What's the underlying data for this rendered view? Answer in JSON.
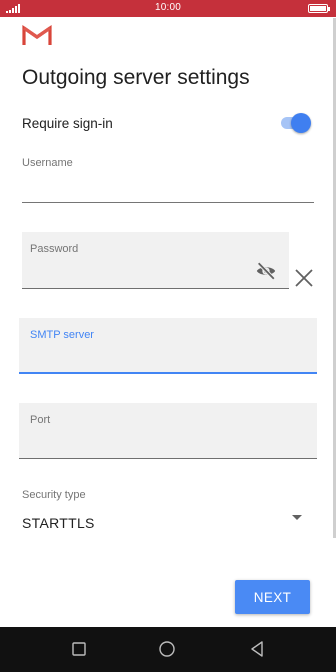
{
  "status_bar": {
    "time": "10:00"
  },
  "header": {
    "app_icon": "gmail-logo",
    "title": "Outgoing server settings"
  },
  "require_signin": {
    "label": "Require sign-in",
    "enabled": true
  },
  "fields": {
    "username": {
      "label": "Username",
      "value": ""
    },
    "password": {
      "label": "Password",
      "value": ""
    },
    "smtp_server": {
      "label": "SMTP server",
      "value": ""
    },
    "port": {
      "label": "Port",
      "value": ""
    }
  },
  "security": {
    "label": "Security type",
    "value": "STARTTLS"
  },
  "actions": {
    "next_label": "NEXT"
  },
  "colors": {
    "status_bar": "#c5303b",
    "accent": "#4285f4",
    "button": "#4a8af4",
    "nav_bar": "#111111"
  },
  "icons": [
    "signal-icon",
    "battery-icon",
    "gmail-logo",
    "toggle-switch",
    "visibility-off-icon",
    "close-icon",
    "dropdown-arrow-icon",
    "recents-icon",
    "home-icon",
    "back-icon"
  ]
}
